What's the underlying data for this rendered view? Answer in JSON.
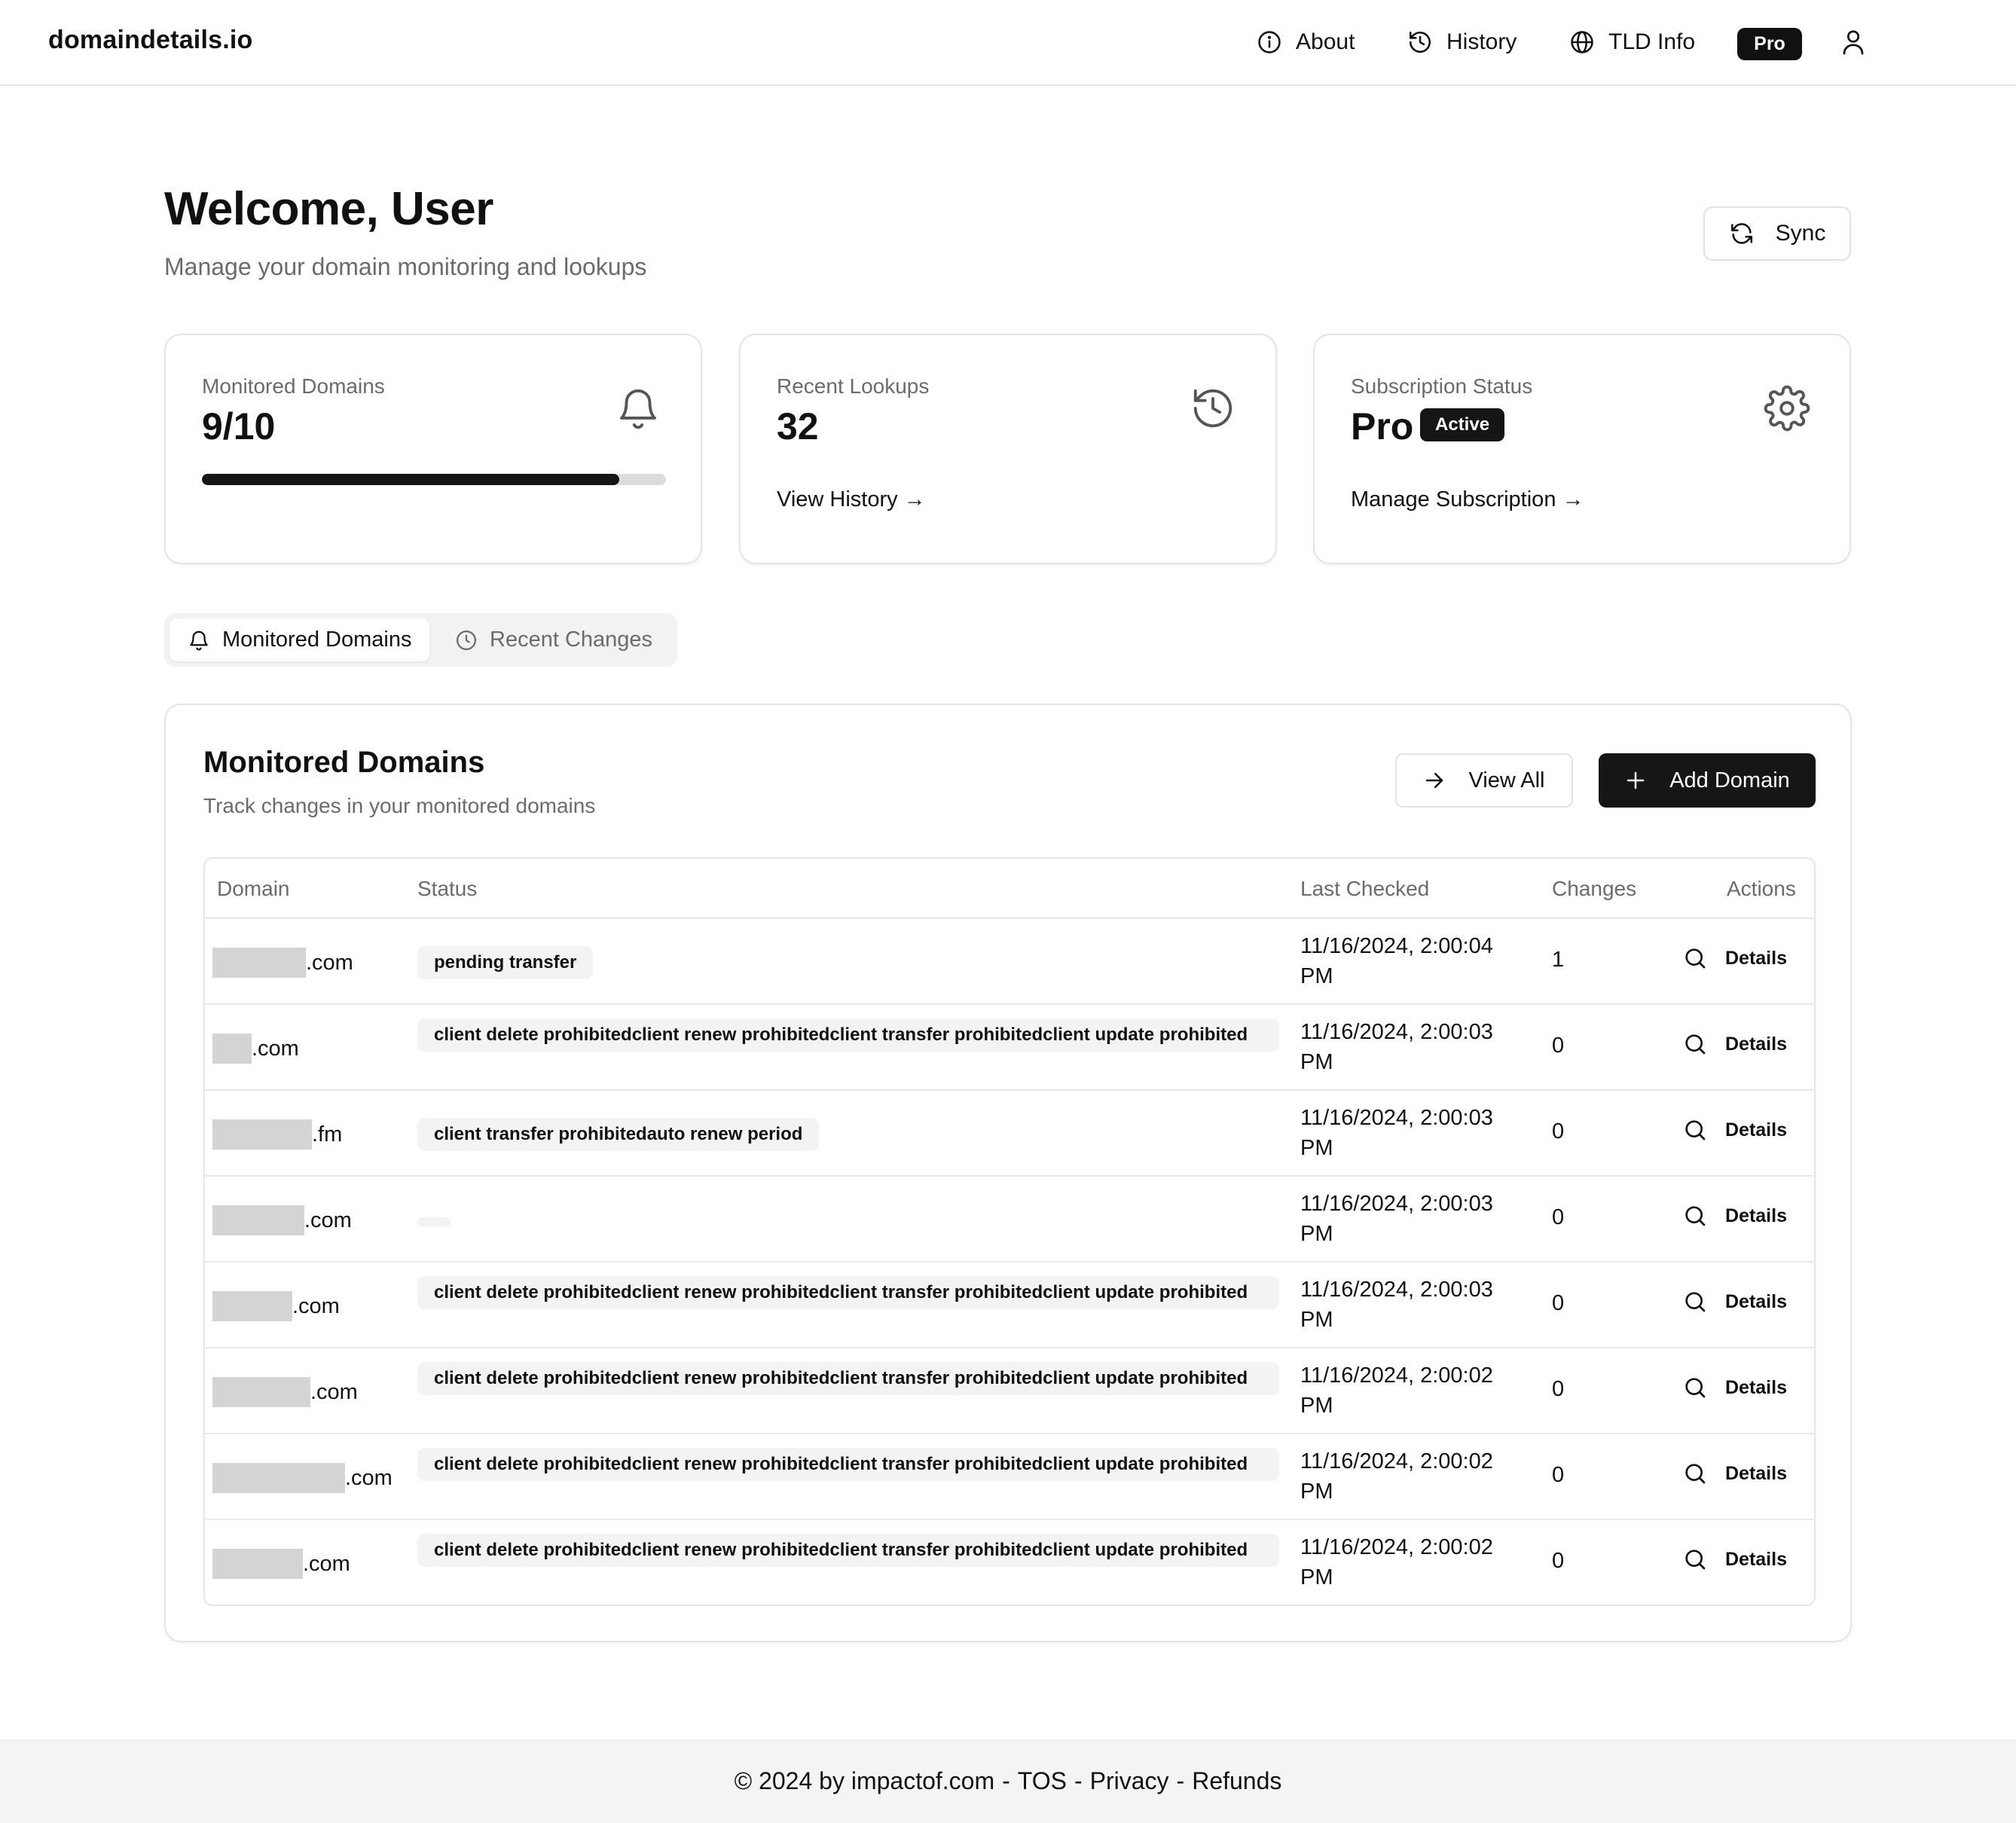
{
  "header": {
    "brand": "domaindetails.io",
    "nav": [
      {
        "label": "About",
        "icon": "info-icon"
      },
      {
        "label": "History",
        "icon": "history-icon"
      },
      {
        "label": "TLD Info",
        "icon": "globe-icon"
      }
    ],
    "plan_badge": "Pro",
    "user_icon": "user-icon"
  },
  "welcome": {
    "title": "Welcome, User",
    "subtitle": "Manage your domain monitoring and lookups",
    "sync_label": "Sync"
  },
  "cards": {
    "monitored": {
      "label": "Monitored Domains",
      "value": "9/10",
      "progress": 0.9,
      "icon": "bell-icon"
    },
    "lookups": {
      "label": "Recent Lookups",
      "value": "32",
      "link": "View History →",
      "icon": "history-icon"
    },
    "subscription": {
      "label": "Subscription Status",
      "value": "Pro",
      "badge": "Active",
      "link": "Manage Subscription →",
      "icon": "gear-icon"
    }
  },
  "tabs": [
    {
      "label": "Monitored Domains",
      "icon": "bell-icon",
      "active": true
    },
    {
      "label": "Recent Changes",
      "icon": "clock-icon",
      "active": false
    }
  ],
  "panel": {
    "title": "Monitored Domains",
    "subtitle": "Track changes in your monitored domains",
    "view_all_label": "View All",
    "add_domain_label": "Add Domain"
  },
  "table": {
    "columns": [
      "Domain",
      "Status",
      "Last Checked",
      "Changes",
      "Actions"
    ],
    "action_label": "Details",
    "rows": [
      {
        "tld": ".com",
        "status": "pending transfer",
        "date_line1": "11/16/2024, 2:00:04",
        "date_line2": "PM",
        "changes": "1"
      },
      {
        "tld": ".com",
        "status": "client delete prohibitedclient renew prohibitedclient transfer prohibitedclient update prohibited",
        "date_line1": "11/16/2024, 2:00:03",
        "date_line2": "PM",
        "changes": "0"
      },
      {
        "tld": ".fm",
        "status": "client transfer prohibitedauto renew period",
        "date_line1": "11/16/2024, 2:00:03",
        "date_line2": "PM",
        "changes": "0"
      },
      {
        "tld": ".com",
        "status": "",
        "date_line1": "11/16/2024, 2:00:03",
        "date_line2": "PM",
        "changes": "0"
      },
      {
        "tld": ".com",
        "status": "client delete prohibitedclient renew prohibitedclient transfer prohibitedclient update prohibited",
        "date_line1": "11/16/2024, 2:00:03",
        "date_line2": "PM",
        "changes": "0"
      },
      {
        "tld": ".com",
        "status": "client delete prohibitedclient renew prohibitedclient transfer prohibitedclient update prohibited",
        "date_line1": "11/16/2024, 2:00:02",
        "date_line2": "PM",
        "changes": "0"
      },
      {
        "tld": ".com",
        "status": "client delete prohibitedclient renew prohibitedclient transfer prohibitedclient update prohibited",
        "date_line1": "11/16/2024, 2:00:02",
        "date_line2": "PM",
        "changes": "0"
      },
      {
        "tld": ".com",
        "status": "client delete prohibitedclient renew prohibitedclient transfer prohibitedclient update prohibited",
        "date_line1": "11/16/2024, 2:00:02",
        "date_line2": "PM",
        "changes": "0"
      }
    ]
  },
  "footer": {
    "copyright": "© 2024 by impactof.com",
    "sep": "-",
    "links": [
      "TOS",
      "Privacy",
      "Refunds"
    ]
  },
  "colors": {
    "primary": "#151515",
    "muted_text": "#6b6b6b",
    "border": "#e4e4e4",
    "pill_bg": "#f3f3f3",
    "footer_bg": "#f3f4f6"
  }
}
